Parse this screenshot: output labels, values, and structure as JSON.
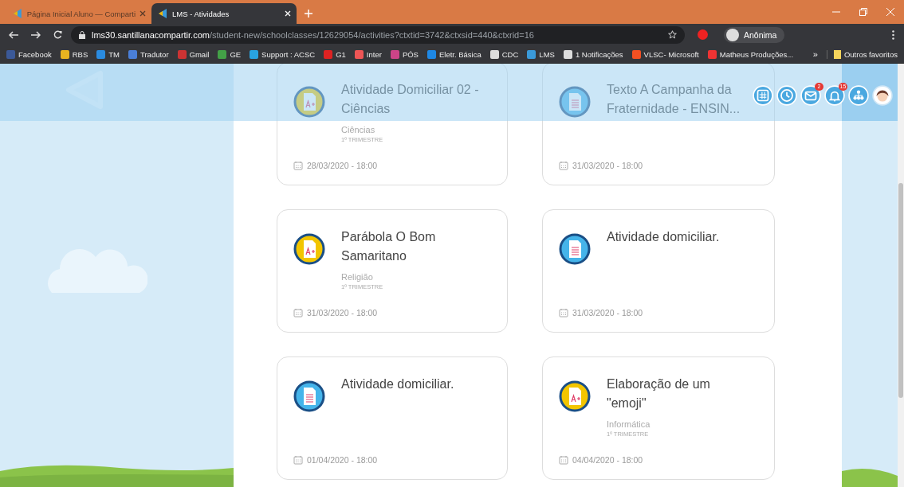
{
  "browser": {
    "tabs": [
      {
        "title": "Página Inicial Aluno — Comparti",
        "selected": false
      },
      {
        "title": "LMS - Atividades",
        "selected": true
      }
    ],
    "address": {
      "host": "lms30.santillanacompartir.com",
      "path": "/student-new/schoolclasses/12629054/activities?ctxtid=3742&ctxsid=440&ctxrid=16"
    },
    "profile": "Anônima",
    "bookmarks": [
      "Facebook",
      "RBS",
      "TM",
      "Tradutor",
      "Gmail",
      "GE",
      "Support : ACSC",
      "G1",
      "Inter",
      "PÓS",
      "Eletr. Básica",
      "CDC",
      "LMS",
      "1 Notificações",
      "VLSC- Microsoft",
      "Matheus Produções..."
    ],
    "more_bookmarks": "»",
    "other_bookmarks": "Outros favoritos"
  },
  "header": {
    "buttons": [
      {
        "kind": "calendar"
      },
      {
        "kind": "clock"
      },
      {
        "kind": "mail",
        "badge": "2"
      },
      {
        "kind": "bell",
        "badge": "15"
      },
      {
        "kind": "hierarchy"
      },
      {
        "kind": "avatar"
      }
    ]
  },
  "activities": [
    {
      "kind": "assignment",
      "title": "Atividade Domiciliar 02 -Ciências",
      "subject": "Ciências",
      "term": "1º TRIMESTRE",
      "due": "28/03/2020 - 18:00"
    },
    {
      "kind": "document",
      "title": "Texto A Campanha da Fraternidade - ENSIN...",
      "due": "31/03/2020 - 18:00"
    },
    {
      "kind": "assignment",
      "title": "Parábola O Bom Samaritano",
      "subject": "Religião",
      "term": "1º TRIMESTRE",
      "due": "31/03/2020 - 18:00"
    },
    {
      "kind": "document",
      "title": "Atividade domiciliar.",
      "due": "31/03/2020 - 18:00"
    },
    {
      "kind": "document",
      "title": "Atividade domiciliar.",
      "due": "01/04/2020 - 18:00"
    },
    {
      "kind": "assignment",
      "title": "Elaboração de um \"emoji\"",
      "subject": "Informática",
      "term": "1º TRIMESTRE",
      "due": "04/04/2020 - 18:00"
    }
  ]
}
